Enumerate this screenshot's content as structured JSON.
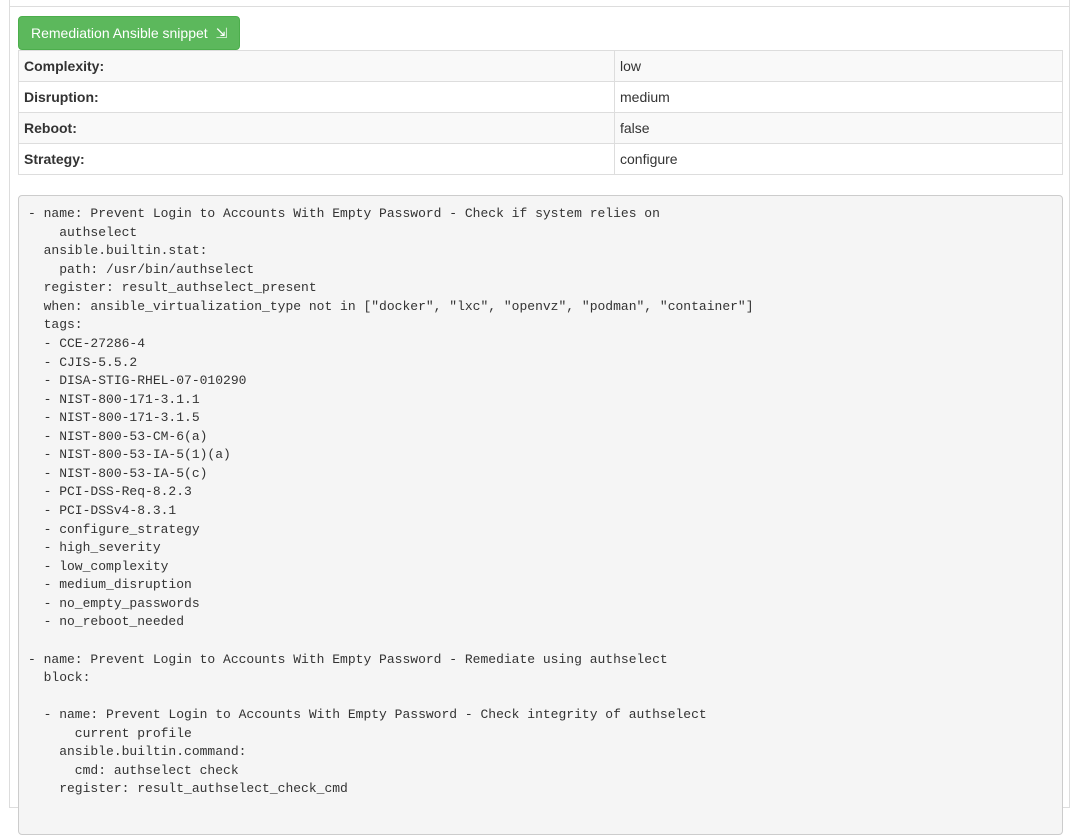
{
  "remediation_button": {
    "label": "Remediation Ansible snippet",
    "icon": "⇲"
  },
  "meta_table": [
    {
      "key": "Complexity:",
      "value": "low"
    },
    {
      "key": "Disruption:",
      "value": "medium"
    },
    {
      "key": "Reboot:",
      "value": "false"
    },
    {
      "key": "Strategy:",
      "value": "configure"
    }
  ],
  "colors": {
    "button_bg": "#5cb85c",
    "code_bg": "#f5f5f5",
    "border": "#dddddd"
  },
  "code": "- name: Prevent Login to Accounts With Empty Password - Check if system relies on\n    authselect\n  ansible.builtin.stat:\n    path: /usr/bin/authselect\n  register: result_authselect_present\n  when: ansible_virtualization_type not in [\"docker\", \"lxc\", \"openvz\", \"podman\", \"container\"]\n  tags:\n  - CCE-27286-4\n  - CJIS-5.5.2\n  - DISA-STIG-RHEL-07-010290\n  - NIST-800-171-3.1.1\n  - NIST-800-171-3.1.5\n  - NIST-800-53-CM-6(a)\n  - NIST-800-53-IA-5(1)(a)\n  - NIST-800-53-IA-5(c)\n  - PCI-DSS-Req-8.2.3\n  - PCI-DSSv4-8.3.1\n  - configure_strategy\n  - high_severity\n  - low_complexity\n  - medium_disruption\n  - no_empty_passwords\n  - no_reboot_needed\n\n- name: Prevent Login to Accounts With Empty Password - Remediate using authselect\n  block:\n\n  - name: Prevent Login to Accounts With Empty Password - Check integrity of authselect\n      current profile\n    ansible.builtin.command:\n      cmd: authselect check\n    register: result_authselect_check_cmd"
}
